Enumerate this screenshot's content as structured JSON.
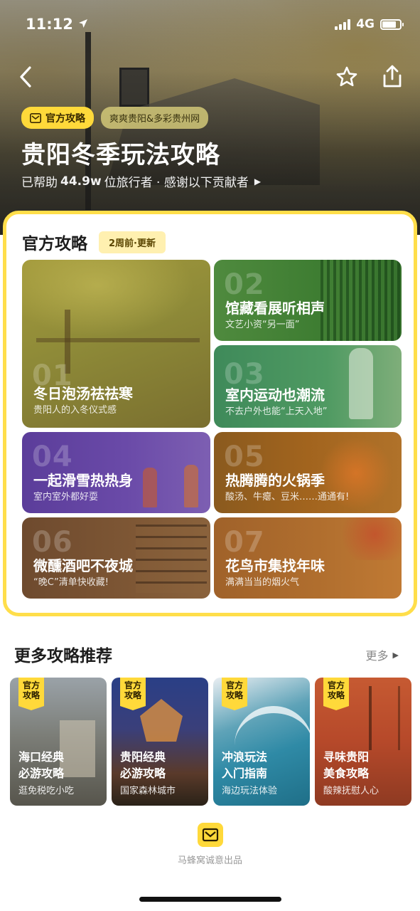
{
  "status": {
    "time": "11:12",
    "network": "4G"
  },
  "hero": {
    "official_tag": "官方攻略",
    "partner_tag": "爽爽贵阳&多彩贵州网",
    "title": "贵阳冬季玩法攻略",
    "helped_prefix": "已帮助",
    "helped_count": "44.9w",
    "helped_suffix": "位旅行者 · 感谢以下贡献者"
  },
  "guide": {
    "title": "官方攻略",
    "updated": "2周前·更新",
    "items": [
      {
        "num": "01",
        "title": "冬日泡汤祛祛寒",
        "subtitle": "贵阳人的入冬仪式感"
      },
      {
        "num": "02",
        "title": "馆藏看展听相声",
        "subtitle": "文艺小资“另一面”"
      },
      {
        "num": "03",
        "title": "室内运动也潮流",
        "subtitle": "不去户外也能“上天入地”"
      },
      {
        "num": "04",
        "title": "一起滑雪热热身",
        "subtitle": "室内室外都好耍"
      },
      {
        "num": "05",
        "title": "热腾腾的火锅季",
        "subtitle": "酸汤、牛瘪、豆米……通通有!"
      },
      {
        "num": "06",
        "title": "微醺酒吧不夜城",
        "subtitle": "“晚C”清单快收藏!"
      },
      {
        "num": "07",
        "title": "花鸟市集找年味",
        "subtitle": "满满当当的烟火气"
      }
    ]
  },
  "more": {
    "title": "更多攻略推荐",
    "link": "更多",
    "badge": "官方攻略",
    "cards": [
      {
        "line1": "海口经典",
        "line2": "必游攻略",
        "subtitle": "逛免税吃小吃"
      },
      {
        "line1": "贵阳经典",
        "line2": "必游攻略",
        "subtitle": "国家森林城市"
      },
      {
        "line1": "冲浪玩法",
        "line2": "入门指南",
        "subtitle": "海边玩法体验"
      },
      {
        "line1": "寻味贵阳",
        "line2": "美食攻略",
        "subtitle": "酸辣抚慰人心"
      }
    ]
  },
  "footer": {
    "text": "马蜂窝诚意出品"
  },
  "colors": {
    "accent_yellow": "#ffd93a",
    "border_yellow": "#ffde4a"
  }
}
